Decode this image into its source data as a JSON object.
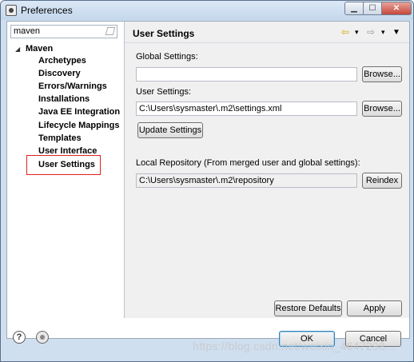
{
  "window": {
    "title": "Preferences",
    "minimize_glyph": "▁",
    "maximize_glyph": "☐",
    "close_glyph": "✕"
  },
  "left_panel": {
    "filter_value": "maven",
    "tree": {
      "expand_glyph": "◢",
      "root": "Maven",
      "items": [
        "Archetypes",
        "Discovery",
        "Errors/Warnings",
        "Installations",
        "Java EE Integration",
        "Lifecycle Mappings",
        "Templates",
        "User Interface",
        "User Settings"
      ]
    },
    "highlight_color": "#e0211b"
  },
  "page": {
    "title": "User Settings",
    "nav": {
      "back": "⇦",
      "back_menu": "▾",
      "forward": "⇨",
      "forward_menu": "▾",
      "view_menu": "▼"
    },
    "global_settings_label": "Global Settings:",
    "global_settings_value": "",
    "browse_label": "Browse...",
    "user_settings_label": "User Settings:",
    "user_settings_value": "C:\\Users\\sysmaster\\.m2\\settings.xml",
    "update_settings_label": "Update Settings",
    "local_repo_label": "Local Repository (From merged user and global settings):",
    "local_repo_value": "C:\\Users\\sysmaster\\.m2\\repository",
    "reindex_label": "Reindex",
    "restore_defaults_label": "Restore Defaults",
    "apply_label": "Apply"
  },
  "footer": {
    "help_glyph": "?",
    "ok_label": "OK",
    "cancel_label": "Cancel",
    "watermark": "https://blog.csdn.net/weixin_4647298..."
  }
}
